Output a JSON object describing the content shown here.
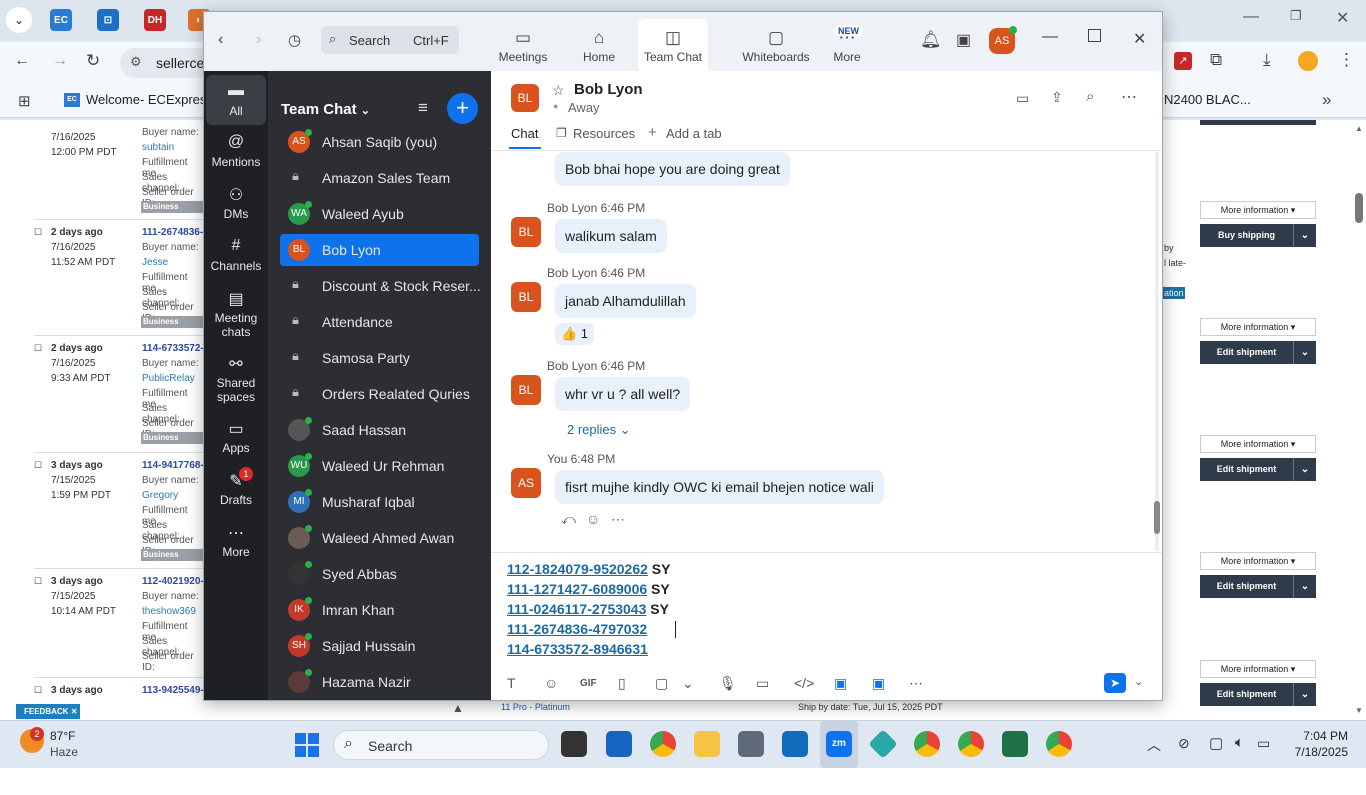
{
  "browser": {
    "address": "sellerce",
    "bookmark": "Welcome- ECExpres...",
    "right_tab": "N2400 BLAC..."
  },
  "orders": [
    {
      "date": "",
      "time1": "7/16/2025",
      "time2": "12:00 PM PDT",
      "id": "",
      "buyer": "subtain"
    },
    {
      "date": "2 days ago",
      "time1": "7/16/2025",
      "time2": "11:52 AM PDT",
      "id": "111-2674836-",
      "buyer": "Jesse"
    },
    {
      "date": "2 days ago",
      "time1": "7/16/2025",
      "time2": "9:33 AM PDT",
      "id": "114-6733572-",
      "buyer": "PublicRelay"
    },
    {
      "date": "3 days ago",
      "time1": "7/15/2025",
      "time2": "1:59 PM PDT",
      "id": "114-9417768-",
      "buyer": "Gregory"
    },
    {
      "date": "3 days ago",
      "time1": "7/15/2025",
      "time2": "10:14 AM PDT",
      "id": "112-4021920-",
      "buyer": "theshow369"
    },
    {
      "date": "3 days ago",
      "time1": "",
      "time2": "",
      "id": "113-9425549-",
      "buyer": ""
    }
  ],
  "order_labels": {
    "buyer": "Buyer name:",
    "fulfillment": "Fulfillment me",
    "sales": "Sales channel:",
    "seller": "Seller order ID:",
    "badge": "Business custom"
  },
  "right_buttons": {
    "more": "More information",
    "buy": "Buy shipping",
    "edit": "Edit shipment"
  },
  "bg_bottom": {
    "product": "11 Pro - Platinum",
    "ship": "Ship by date: Tue, Jul 15, 2025 PDT",
    "right_by": "by",
    "right_late": "l late-",
    "right_ation": "ation"
  },
  "feedback": "FEEDBACK",
  "zoom": {
    "search": "Search",
    "shortcut": "Ctrl+F",
    "nav": [
      {
        "label": "Meetings",
        "icon": "video-icon"
      },
      {
        "label": "Home",
        "icon": "home-icon"
      },
      {
        "label": "Team Chat",
        "icon": "chat-icon"
      },
      {
        "label": "Whiteboards",
        "icon": "whiteboard-icon"
      },
      {
        "label": "More",
        "icon": "more-icon"
      }
    ],
    "new_badge": "NEW",
    "user_initials": "AS",
    "left_nav": [
      {
        "label": "All"
      },
      {
        "label": "Mentions"
      },
      {
        "label": "DMs"
      },
      {
        "label": "Channels"
      },
      {
        "label": "Meeting chats"
      },
      {
        "label": "Shared spaces"
      },
      {
        "label": "Apps"
      },
      {
        "label": "Drafts",
        "badge": "1"
      },
      {
        "label": "More"
      }
    ],
    "list_title": "Team Chat",
    "contacts": [
      {
        "name": "Ahsan Saqib (you)",
        "initials": "AS",
        "color": "#d9531e"
      },
      {
        "name": "Amazon Sales Team",
        "initials": "",
        "color": ""
      },
      {
        "name": "Waleed Ayub",
        "initials": "WA",
        "color": "#2a9b4a"
      },
      {
        "name": "Bob Lyon",
        "initials": "BL",
        "color": "#d9531e"
      },
      {
        "name": "Discount & Stock Reser...",
        "initials": "",
        "color": ""
      },
      {
        "name": "Attendance",
        "initials": "",
        "color": ""
      },
      {
        "name": "Samosa Party",
        "initials": "",
        "color": ""
      },
      {
        "name": "Orders Realated Quries",
        "initials": "",
        "color": ""
      },
      {
        "name": "Saad Hassan",
        "initials": "",
        "color": "#555"
      },
      {
        "name": "Waleed Ur Rehman",
        "initials": "WU",
        "color": "#2a9b4a"
      },
      {
        "name": "Musharaf Iqbal",
        "initials": "MI",
        "color": "#2f6fb5"
      },
      {
        "name": "Waleed Ahmed Awan",
        "initials": "",
        "color": "#6b5a55"
      },
      {
        "name": "Syed Abbas",
        "initials": "",
        "color": "#333"
      },
      {
        "name": "Imran Khan",
        "initials": "IK",
        "color": "#c0392b"
      },
      {
        "name": "Sajjad Hussain",
        "initials": "SH",
        "color": "#c0392b"
      },
      {
        "name": "Hazama Nazir",
        "initials": "",
        "color": "#5a3a3a"
      }
    ],
    "chat": {
      "name": "Bob Lyon",
      "initials": "BL",
      "status": "Away",
      "tabs": [
        "Chat",
        "Resources",
        "Add a tab"
      ],
      "messages": [
        {
          "sender": "",
          "text": "Bob bhai hope you are doing great"
        },
        {
          "sender": "Bob Lyon 6:46 PM",
          "text": "walikum salam"
        },
        {
          "sender": "Bob Lyon 6:46 PM",
          "text": "janab Alhamdulillah"
        },
        {
          "sender": "Bob Lyon 6:46 PM",
          "text": "whr vr u ? all well?"
        },
        {
          "sender": "You 6:48 PM",
          "text": "fisrt mujhe kindly OWC ki email bhejen notice wali"
        }
      ],
      "reaction": "👍 1",
      "replies": "2 replies",
      "draft_lines": [
        {
          "link": "112-1824079-9520262",
          "suffix": "SY"
        },
        {
          "link": "111-1271427-6089006",
          "suffix": "SY"
        },
        {
          "link": "111-0246117-2753043",
          "suffix": "SY"
        },
        {
          "link": "111-2674836-4797032",
          "suffix": ""
        },
        {
          "link": "114-6733572-8946631",
          "suffix": ""
        }
      ]
    }
  },
  "taskbar": {
    "weather_temp": "87°F",
    "weather_desc": "Haze",
    "weather_badge": "2",
    "search": "Search",
    "time": "7:04 PM",
    "date": "7/18/2025"
  }
}
